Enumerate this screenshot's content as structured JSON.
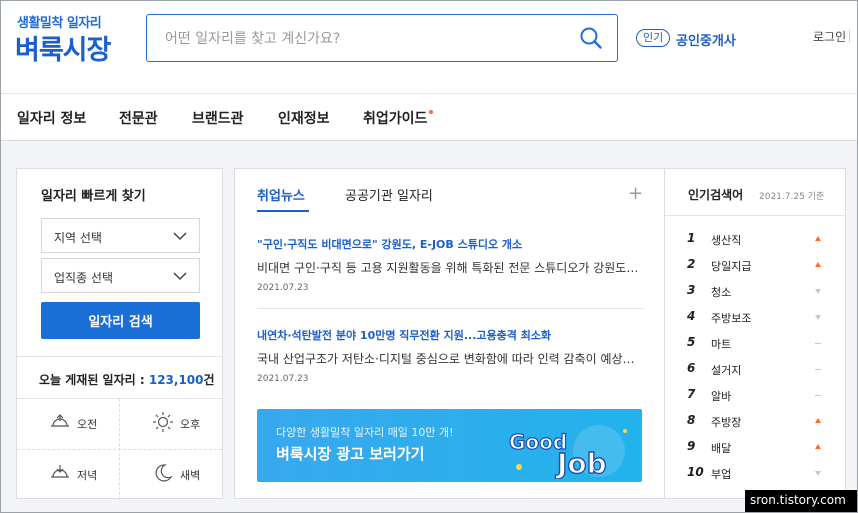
{
  "header": {
    "logo_top": "생활밀착 일자리",
    "logo_main": "벼룩시장",
    "search_placeholder": "어떤 일자리를 찾고 계신가요?",
    "popular_badge": "인기",
    "broker_link": "공인중개사",
    "login": "로그인"
  },
  "nav": {
    "items": [
      "일자리 정보",
      "전문관",
      "브랜드관",
      "인재정보",
      "취업가이드"
    ]
  },
  "quick": {
    "title": "일자리 빠르게 찾기",
    "region_select": "지역 선택",
    "job_select": "업직종 선택",
    "search_button": "일자리 검색",
    "today_label": "오늘 게재된 일자리 :",
    "today_count": "123,100",
    "today_unit": "건",
    "times": [
      "오전",
      "오후",
      "저녁",
      "새벽"
    ]
  },
  "news": {
    "tabs": [
      "취업뉴스",
      "공공기관 일자리"
    ],
    "plus": "+",
    "items": [
      {
        "title": "\"구인·구직도 비대면으로\" 강원도, E-JOB 스튜디오 개소",
        "summary": "비대면 구인·구직 등 고용 지원활동을 위해 특화된 전문 스튜디오가 강원도에 ...",
        "date": "2021.07.23"
      },
      {
        "title": "내연차·석탄발전 분야 10만명 직무전환 지원...고용충격 최소화",
        "summary": "국내 산업구조가 저탄소·디지털 중심으로 변화함에 따라 인력 감축이 예상되는...",
        "date": "2021.07.23"
      }
    ],
    "banner_line1": "다양한 생활밀착 일자리 매일 10만 개!",
    "banner_line2": "벼룩시장 광고 보러가기",
    "banner_logo_text": [
      "Good",
      "Job"
    ]
  },
  "ranking": {
    "title": "인기검색어",
    "date": "2021.7.25 기준",
    "items": [
      {
        "rank": "1",
        "keyword": "생산직",
        "trend": "up"
      },
      {
        "rank": "2",
        "keyword": "당일지급",
        "trend": "up"
      },
      {
        "rank": "3",
        "keyword": "청소",
        "trend": "down"
      },
      {
        "rank": "4",
        "keyword": "주방보조",
        "trend": "down"
      },
      {
        "rank": "5",
        "keyword": "마트",
        "trend": "same"
      },
      {
        "rank": "6",
        "keyword": "설거지",
        "trend": "same"
      },
      {
        "rank": "7",
        "keyword": "알바",
        "trend": "same"
      },
      {
        "rank": "8",
        "keyword": "주방장",
        "trend": "up"
      },
      {
        "rank": "9",
        "keyword": "배달",
        "trend": "up"
      },
      {
        "rank": "10",
        "keyword": "부업",
        "trend": "down"
      }
    ]
  },
  "watermark": "sron.tistory.com",
  "colors": {
    "brand_blue": "#1a5fcc",
    "button_blue": "#1a6fd6",
    "trend_up": "#ff6a2a",
    "banner": "#2bb0ee"
  }
}
